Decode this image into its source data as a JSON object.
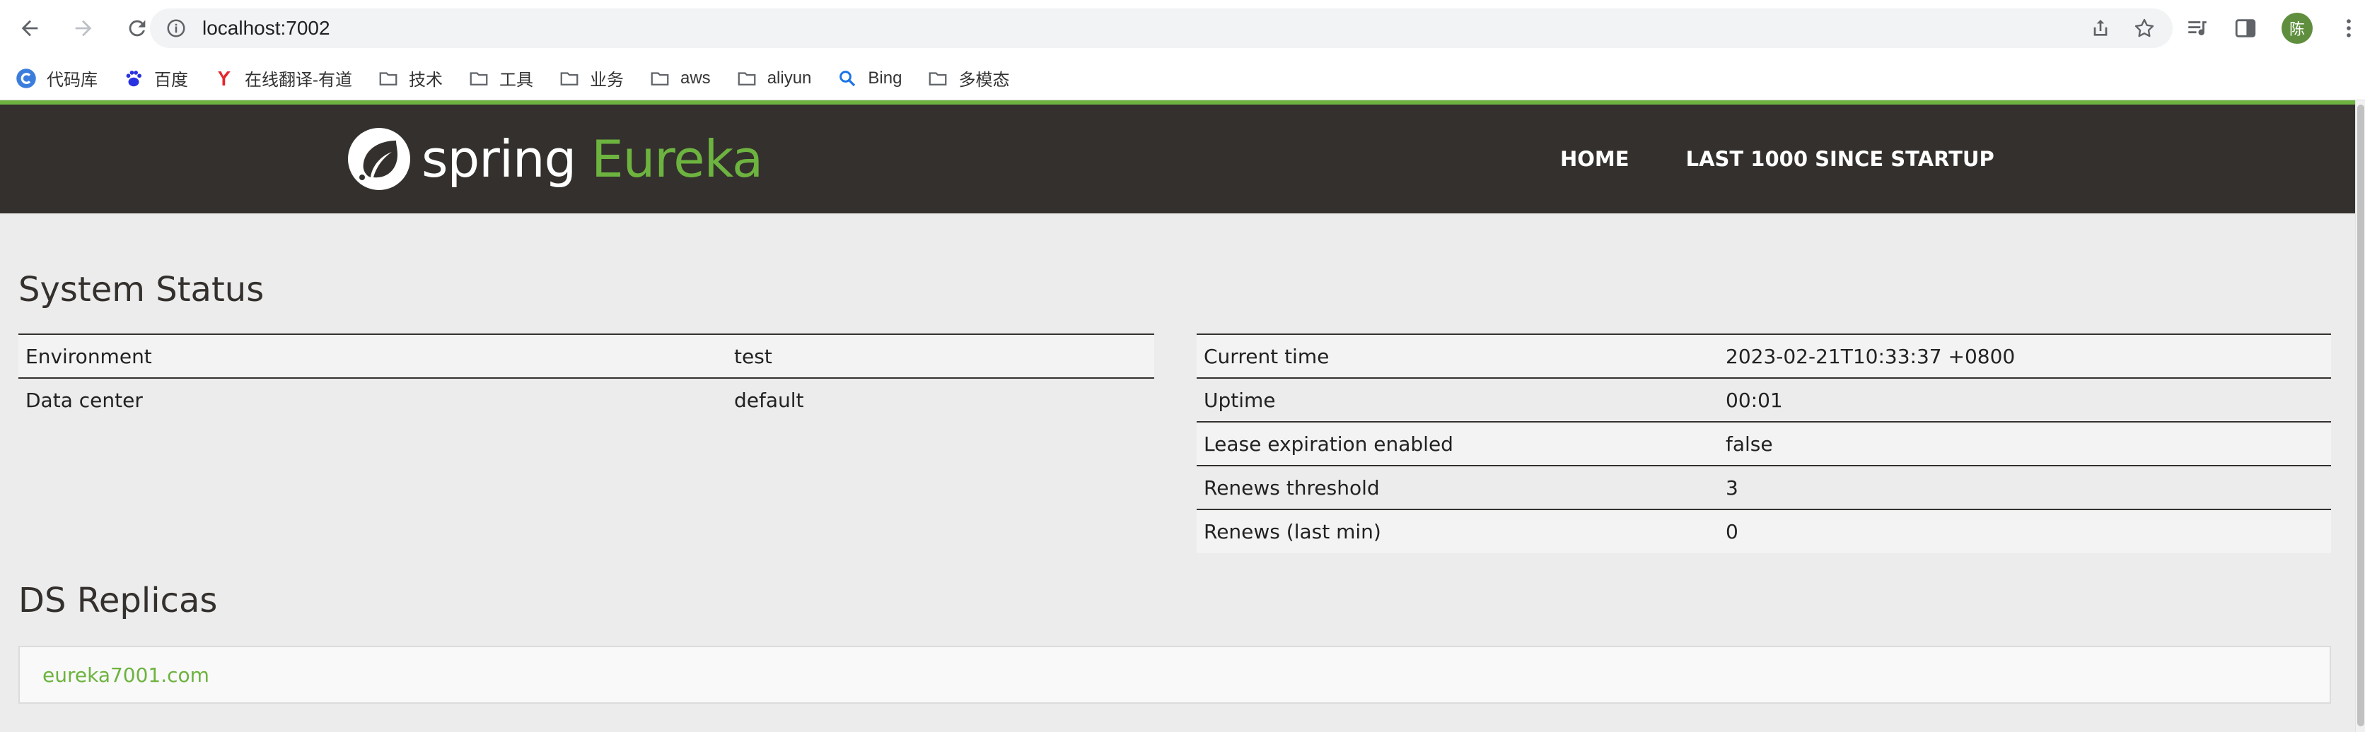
{
  "browser": {
    "url": "localhost:7002",
    "avatar_initial": "陈",
    "bookmarks": [
      {
        "label": "代码库",
        "icon": "c-logo-icon"
      },
      {
        "label": "百度",
        "icon": "baidu-paw-icon"
      },
      {
        "label": "在线翻译-有道",
        "icon": "youdao-icon"
      },
      {
        "label": "技术",
        "icon": "folder-icon"
      },
      {
        "label": "工具",
        "icon": "folder-icon"
      },
      {
        "label": "业务",
        "icon": "folder-icon"
      },
      {
        "label": "aws",
        "icon": "folder-icon"
      },
      {
        "label": "aliyun",
        "icon": "folder-icon"
      },
      {
        "label": "Bing",
        "icon": "bing-search-icon"
      },
      {
        "label": "多模态",
        "icon": "folder-icon"
      }
    ]
  },
  "header": {
    "brand_spring": "spring",
    "brand_eureka": "Eureka",
    "nav": [
      "HOME",
      "LAST 1000 SINCE STARTUP"
    ],
    "accent_color": "#6db33f",
    "bar_color": "#34302d"
  },
  "system_status": {
    "title": "System Status",
    "left_table": [
      {
        "label": "Environment",
        "value": "test"
      },
      {
        "label": "Data center",
        "value": "default"
      }
    ],
    "right_table": [
      {
        "label": "Current time",
        "value": "2023-02-21T10:33:37 +0800"
      },
      {
        "label": "Uptime",
        "value": "00:01"
      },
      {
        "label": "Lease expiration enabled",
        "value": "false"
      },
      {
        "label": "Renews threshold",
        "value": "3"
      },
      {
        "label": "Renews (last min)",
        "value": "0"
      }
    ]
  },
  "ds_replicas": {
    "title": "DS Replicas",
    "replicas": [
      "eureka7001.com"
    ]
  }
}
